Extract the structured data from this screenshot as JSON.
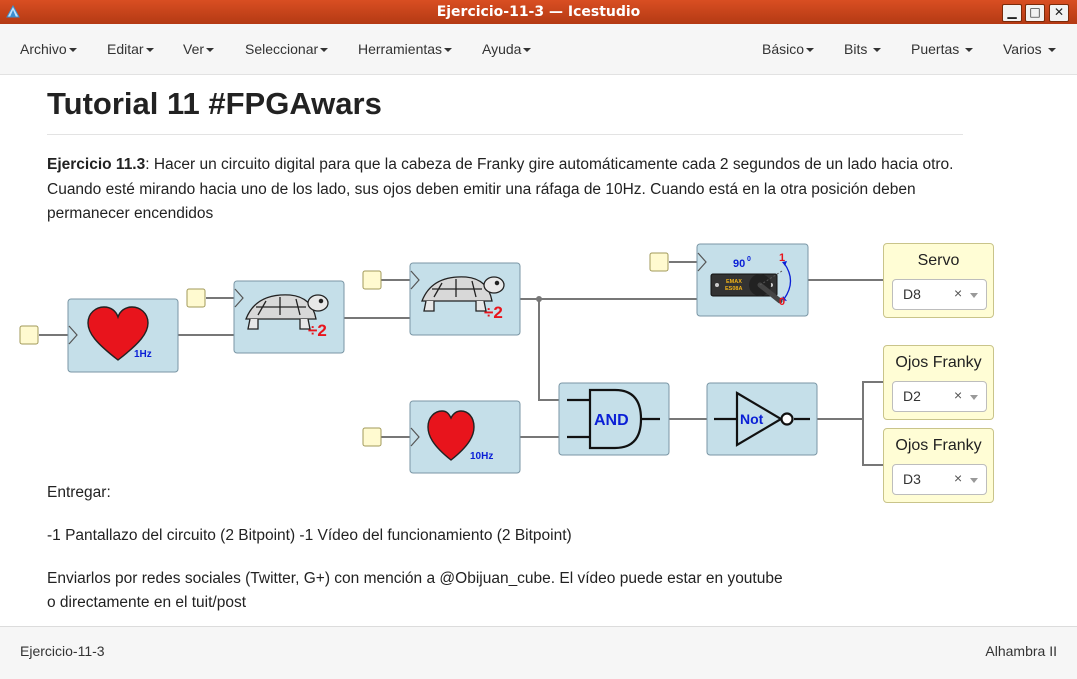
{
  "window": {
    "title": "Ejercicio-11-3 — Icestudio",
    "buttons": {
      "minimize": "▁",
      "maximize": "□",
      "close": "✕"
    }
  },
  "menu": {
    "left": [
      "Archivo",
      "Editar",
      "Ver",
      "Seleccionar",
      "Herramientas",
      "Ayuda"
    ],
    "right": [
      "Básico",
      "Bits",
      "Puertas",
      "Varios"
    ]
  },
  "content": {
    "heading": "Tutorial 11 #FPGAwars",
    "exercise_label": "Ejercicio 11.3",
    "exercise_text": ": Hacer un circuito digital para que la cabeza de Franky gire automáticamente cada 2 segundos de un lado hacia otro. Cuando esté mirando hacia uno de los lado, sus ojos deben emitir una ráfaga de 10Hz. Cuando está en la otra posición deben permanecer encendidos",
    "deliver": "Entregar:",
    "deliver_items": "-1 Pantallazo del circuito (2 Bitpoint) -1 Vídeo del funcionamiento (2 Bitpoint)",
    "send_line1": "Enviarlos por redes sociales (Twitter, G+) con mención a @Obijuan_cube. El vídeo puede estar en youtube",
    "send_line2": "o directamente en el tuit/post"
  },
  "circuit": {
    "heart1_label": "1Hz",
    "heart2_label": "10Hz",
    "div_label": "÷2",
    "servo_angle": "90",
    "servo_deg": "0",
    "servo_one": "1",
    "servo_zero": "0",
    "servo_brand1": "EMAX",
    "servo_brand2": "ES08A",
    "and_label": "AND",
    "not_label": "Not",
    "outputs": [
      {
        "label": "Servo",
        "pin": "D8"
      },
      {
        "label": "Ojos Franky",
        "pin": "D2"
      },
      {
        "label": "Ojos Franky",
        "pin": "D3"
      }
    ],
    "clear_symbol": "×"
  },
  "status": {
    "left": "Ejercicio-11-3",
    "right": "Alhambra II"
  },
  "colors": {
    "title_bar": "#c8441b",
    "block_fill": "#c5dfe9",
    "output_fill": "#fffdd5",
    "heart": "#e8141c",
    "label_blue": "#0a1fd6",
    "label_red": "#e8141c"
  }
}
